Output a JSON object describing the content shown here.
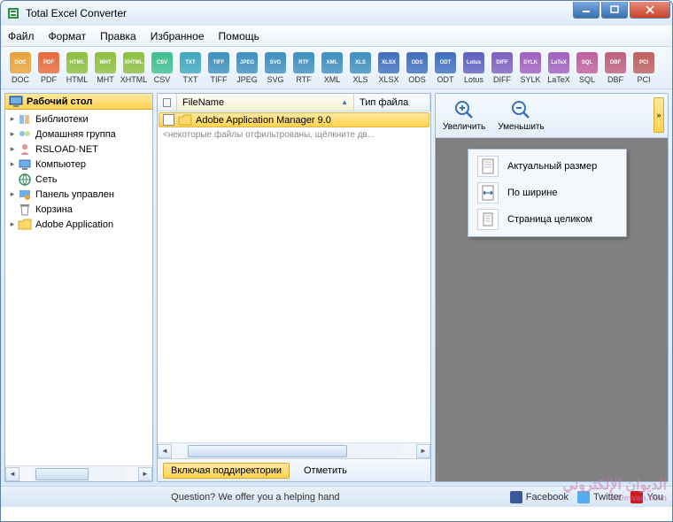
{
  "window": {
    "title": "Total Excel Converter"
  },
  "menu": {
    "file": "Файл",
    "format": "Формат",
    "edit": "Правка",
    "fav": "Избранное",
    "help": "Помощь"
  },
  "formats": [
    {
      "label": "DOC",
      "color": "#e8a33a"
    },
    {
      "label": "PDF",
      "color": "#e86a3a"
    },
    {
      "label": "HTML",
      "color": "#8fbf3f"
    },
    {
      "label": "MHT",
      "color": "#8fbf3f"
    },
    {
      "label": "XHTML",
      "color": "#8fbf3f"
    },
    {
      "label": "CSV",
      "color": "#3fbf8f"
    },
    {
      "label": "TXT",
      "color": "#3fa8bf"
    },
    {
      "label": "TIFF",
      "color": "#3f8fbf"
    },
    {
      "label": "JPEG",
      "color": "#3f8fbf"
    },
    {
      "label": "SVG",
      "color": "#3f8fbf"
    },
    {
      "label": "RTF",
      "color": "#3f8fbf"
    },
    {
      "label": "XML",
      "color": "#3f8fbf"
    },
    {
      "label": "XLS",
      "color": "#3f8fbf"
    },
    {
      "label": "XLSX",
      "color": "#3f6fbf"
    },
    {
      "label": "ODS",
      "color": "#3f6fbf"
    },
    {
      "label": "ODT",
      "color": "#3f6fbf"
    },
    {
      "label": "Lotus",
      "color": "#5f5fbf"
    },
    {
      "label": "DIFF",
      "color": "#7f5fbf"
    },
    {
      "label": "SYLK",
      "color": "#9f5fbf"
    },
    {
      "label": "LaTeX",
      "color": "#9f5fbf"
    },
    {
      "label": "SQL",
      "color": "#bf5f9f"
    },
    {
      "label": "DBF",
      "color": "#bf5f7f"
    },
    {
      "label": "PCI",
      "color": "#bf5f5f"
    }
  ],
  "tree": {
    "root": "Рабочий стол",
    "items": [
      {
        "label": "Библиотеки",
        "expandable": true,
        "icon": "libraries"
      },
      {
        "label": "Домашняя группа",
        "expandable": true,
        "icon": "homegroup"
      },
      {
        "label": "RSLOAD·NET",
        "expandable": true,
        "icon": "user"
      },
      {
        "label": "Компьютер",
        "expandable": true,
        "icon": "computer"
      },
      {
        "label": "Сеть",
        "expandable": false,
        "icon": "network"
      },
      {
        "label": "Панель управлен",
        "expandable": true,
        "icon": "control"
      },
      {
        "label": "Корзина",
        "expandable": false,
        "icon": "recycle"
      },
      {
        "label": "Adobe Application",
        "expandable": true,
        "icon": "folder"
      }
    ]
  },
  "filelist": {
    "col_check": "",
    "col_name": "FileName",
    "col_type": "Тип файла",
    "row0": "Adobe Application Manager 9.0",
    "filter_note": "<некоторые файлы отфильтрованы, щёлкните дв...",
    "btn_include": "Включая поддиректории",
    "btn_mark": "Отметить"
  },
  "preview": {
    "zoom_in": "Увеличить",
    "zoom_out": "Уменьшить",
    "ctx_actual": "Актуальный размер",
    "ctx_width": "По ширине",
    "ctx_page": "Страница целиком"
  },
  "status": {
    "help": "Question? We offer you a helping hand",
    "fb": "Facebook",
    "tw": "Twitter",
    "yt": "You"
  },
  "watermark": {
    "main": "الديوان الإلكتروني",
    "sub": "e-Dewan.com"
  }
}
